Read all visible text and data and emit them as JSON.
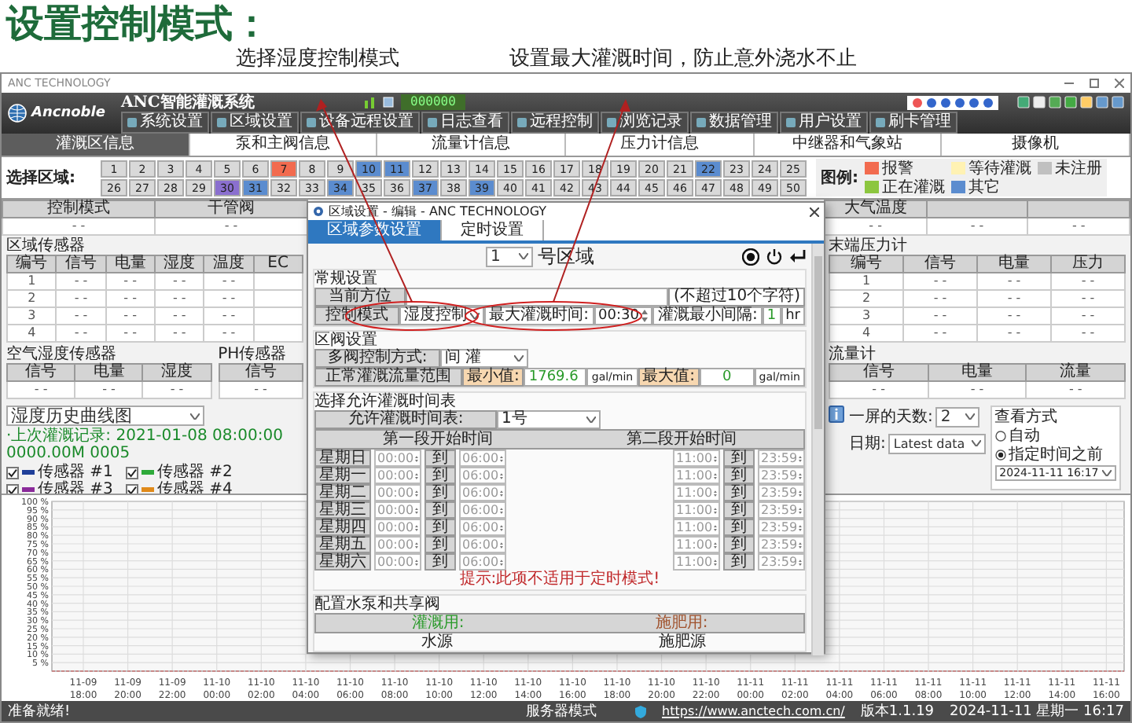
{
  "slide": {
    "title": "设置控制模式：",
    "annotations": [
      "选择湿度控制模式",
      "设置最大灌溉时间，防止意外浇水不止"
    ]
  },
  "window": {
    "title": "ANC TECHNOLOGY"
  },
  "header": {
    "brand": "Ancnoble",
    "app_title": "ANC智能灌溉系统",
    "display": "000000",
    "menu": [
      "系统设置",
      "区域设置",
      "设备远程设置",
      "日志查看",
      "远程控制",
      "浏览记录",
      "数据管理",
      "用户设置",
      "刷卡管理"
    ]
  },
  "tabs": [
    {
      "label": "灌溉区信息",
      "selected": true
    },
    {
      "label": "泵和主阀信息",
      "selected": false
    },
    {
      "label": "流量计信息",
      "selected": false
    },
    {
      "label": "压力计信息",
      "selected": false
    },
    {
      "label": "中继器和气象站",
      "selected": false
    },
    {
      "label": "摄像机",
      "selected": false
    }
  ],
  "zones": {
    "label": "选择区域:",
    "items": [
      {
        "number": "1",
        "color": "#d9d9d9"
      },
      {
        "number": "2",
        "color": "#d9d9d9"
      },
      {
        "number": "3",
        "color": "#d9d9d9"
      },
      {
        "number": "4",
        "color": "#d9d9d9"
      },
      {
        "number": "5",
        "color": "#d9d9d9"
      },
      {
        "number": "6",
        "color": "#d9d9d9"
      },
      {
        "number": "7",
        "color": "#f26b4f"
      },
      {
        "number": "8",
        "color": "#d9d9d9"
      },
      {
        "number": "9",
        "color": "#d9d9d9"
      },
      {
        "number": "10",
        "color": "#5b8ccf"
      },
      {
        "number": "11",
        "color": "#5b8ccf"
      },
      {
        "number": "12",
        "color": "#d9d9d9"
      },
      {
        "number": "13",
        "color": "#d9d9d9"
      },
      {
        "number": "14",
        "color": "#d9d9d9"
      },
      {
        "number": "15",
        "color": "#d9d9d9"
      },
      {
        "number": "16",
        "color": "#d9d9d9"
      },
      {
        "number": "17",
        "color": "#d9d9d9"
      },
      {
        "number": "18",
        "color": "#d9d9d9"
      },
      {
        "number": "19",
        "color": "#d9d9d9"
      },
      {
        "number": "20",
        "color": "#d9d9d9"
      },
      {
        "number": "21",
        "color": "#d9d9d9"
      },
      {
        "number": "22",
        "color": "#5b8ccf"
      },
      {
        "number": "23",
        "color": "#d9d9d9"
      },
      {
        "number": "24",
        "color": "#d9d9d9"
      },
      {
        "number": "25",
        "color": "#d9d9d9"
      },
      {
        "number": "26",
        "color": "#d9d9d9"
      },
      {
        "number": "27",
        "color": "#d9d9d9"
      },
      {
        "number": "28",
        "color": "#d9d9d9"
      },
      {
        "number": "29",
        "color": "#d9d9d9"
      },
      {
        "number": "30",
        "color": "#8a6fcf"
      },
      {
        "number": "31",
        "color": "#5b8ccf"
      },
      {
        "number": "32",
        "color": "#d9d9d9"
      },
      {
        "number": "33",
        "color": "#d9d9d9"
      },
      {
        "number": "34",
        "color": "#5b8ccf"
      },
      {
        "number": "35",
        "color": "#d9d9d9"
      },
      {
        "number": "36",
        "color": "#d9d9d9"
      },
      {
        "number": "37",
        "color": "#5b8ccf"
      },
      {
        "number": "38",
        "color": "#d9d9d9"
      },
      {
        "number": "39",
        "color": "#5b8ccf"
      },
      {
        "number": "40",
        "color": "#d9d9d9"
      },
      {
        "number": "41",
        "color": "#d9d9d9"
      },
      {
        "number": "42",
        "color": "#d9d9d9"
      },
      {
        "number": "43",
        "color": "#d9d9d9"
      },
      {
        "number": "44",
        "color": "#d9d9d9"
      },
      {
        "number": "45",
        "color": "#d9d9d9"
      },
      {
        "number": "46",
        "color": "#d9d9d9"
      },
      {
        "number": "47",
        "color": "#d9d9d9"
      },
      {
        "number": "48",
        "color": "#d9d9d9"
      },
      {
        "number": "49",
        "color": "#d9d9d9"
      },
      {
        "number": "50",
        "color": "#d9d9d9"
      }
    ]
  },
  "legend": {
    "title": "图例:",
    "items": [
      {
        "label": "报警",
        "color": "#f26b4f"
      },
      {
        "label": "等待灌溉",
        "color": "#fff2b3"
      },
      {
        "label": "未注册",
        "color": "#c0c0c0"
      },
      {
        "label": "正在灌溉",
        "color": "#8cc63f"
      },
      {
        "label": "其它",
        "color": "#5b8ccf"
      }
    ]
  },
  "summary": {
    "left": [
      {
        "header": "控制模式",
        "value": "- -"
      },
      {
        "header": "干管阀",
        "value": "- -"
      }
    ],
    "right": [
      {
        "header": "大气温度",
        "value": "- -"
      },
      {
        "value": "- -"
      },
      {
        "value": "- -"
      }
    ]
  },
  "zone_sensors": {
    "title": "区域传感器",
    "columns": [
      "编号",
      "信号",
      "电量",
      "湿度",
      "温度",
      "EC"
    ],
    "rows": [
      [
        "1",
        "- -",
        "- -",
        "- -",
        "- -"
      ],
      [
        "2",
        "- -",
        "- -",
        "- -",
        "- -"
      ],
      [
        "3",
        "- -",
        "- -",
        "- -",
        "- -"
      ],
      [
        "4",
        "- -",
        "- -",
        "- -",
        "- -"
      ]
    ]
  },
  "air_sensor": {
    "title": "空气湿度传感器",
    "columns": [
      "信号",
      "电量",
      "湿度"
    ],
    "row": [
      "- -",
      "- -",
      "- -"
    ]
  },
  "ph_sensor": {
    "title": "PH传感器",
    "columns": [
      "信号"
    ],
    "row": [
      "- -"
    ]
  },
  "pressure": {
    "title": "末端压力计",
    "columns": [
      "编号",
      "信号",
      "电量",
      "压力"
    ],
    "rows": [
      [
        "1",
        "- -",
        "- -",
        "- -"
      ],
      [
        "2",
        "- -",
        "- -",
        "- -"
      ],
      [
        "3",
        "- -",
        "- -",
        "- -"
      ],
      [
        "4",
        "- -",
        "- -",
        "- -"
      ]
    ]
  },
  "flow": {
    "title": "流量计",
    "columns": [
      "信号",
      "电量",
      "流量"
    ],
    "row": [
      "- -",
      "- -",
      "- -"
    ]
  },
  "chart_panel": {
    "selector": "湿度历史曲线图",
    "last_record": "·上次灌溉记录: 2021-01-08 08:00:00 0000.00M 0005",
    "legend": [
      {
        "checked": true
      },
      {
        "checked": true
      },
      {
        "checked": true
      },
      {
        "checked": true
      }
    ],
    "days_label": "一屏的天数:",
    "days": "2",
    "date_label": "日期:",
    "date": "Latest data",
    "view_mode": {
      "title": "查看方式",
      "options": [
        {
          "label": "自动",
          "selected": false
        },
        {
          "label": "指定时间之前",
          "selected": true
        }
      ],
      "datetime": "2024-11-11 16:17"
    },
    "chart_data": {
      "type": "line",
      "grid": true,
      "categories": [
        "11-09 18:00",
        "11-09 20:00",
        "11-09 22:00",
        "11-10 00:00",
        "11-10 02:00",
        "11-10 04:00",
        "11-10 06:00",
        "11-10 08:00",
        "11-10 10:00",
        "11-10 12:00",
        "11-10 14:00",
        "11-10 16:00",
        "11-10 18:00",
        "11-10 20:00",
        "11-10 22:00",
        "11-11 00:00",
        "11-11 02:00",
        "11-11 04:00",
        "11-11 06:00",
        "11-11 08:00",
        "11-11 10:00",
        "11-11 12:00",
        "11-11 14:00",
        "11-11 16:00"
      ],
      "ylim": [
        0,
        100
      ],
      "yticks": [
        {
          "value": 5,
          "label": "5 %"
        },
        {
          "value": 10,
          "label": "10 %"
        },
        {
          "value": 15,
          "label": "15 %"
        },
        {
          "value": 20,
          "label": "20 %"
        },
        {
          "value": 25,
          "label": "25 %"
        },
        {
          "value": 30,
          "label": "30 %"
        },
        {
          "value": 35,
          "label": "35 %"
        },
        {
          "value": 40,
          "label": "40 %"
        },
        {
          "value": 45,
          "label": "45 %"
        },
        {
          "value": 50,
          "label": "50 %"
        },
        {
          "value": 55,
          "label": "55 %"
        },
        {
          "value": 60,
          "label": "60 %"
        },
        {
          "value": 65,
          "label": "65 %"
        },
        {
          "value": 70,
          "label": "70 %"
        },
        {
          "value": 75,
          "label": "75 %"
        },
        {
          "value": 80,
          "label": "80 %"
        },
        {
          "value": 85,
          "label": "85 %"
        },
        {
          "value": 90,
          "label": "90 %"
        },
        {
          "value": 95,
          "label": "95 %"
        },
        {
          "value": 100,
          "label": "100 %"
        }
      ],
      "series": [
        {
          "name": "传感器 #1",
          "color": "#1f3f99",
          "values": [
            null,
            null,
            null,
            null,
            null,
            null,
            null,
            null,
            null,
            null,
            null,
            null,
            null,
            null,
            null,
            null,
            null,
            null,
            null,
            null,
            null,
            null,
            null,
            null
          ]
        },
        {
          "name": "传感器 #2",
          "color": "#2eaa3a",
          "values": [
            null,
            null,
            null,
            null,
            null,
            null,
            null,
            null,
            null,
            null,
            null,
            null,
            null,
            null,
            null,
            null,
            null,
            null,
            null,
            null,
            null,
            null,
            null,
            null
          ]
        },
        {
          "name": "传感器 #3",
          "color": "#8a2a9a",
          "values": [
            null,
            null,
            null,
            null,
            null,
            null,
            null,
            null,
            null,
            null,
            null,
            null,
            null,
            null,
            null,
            null,
            null,
            null,
            null,
            null,
            null,
            null,
            null,
            null
          ]
        },
        {
          "name": "传感器 #4",
          "color": "#e08a1a",
          "values": [
            null,
            null,
            null,
            null,
            null,
            null,
            null,
            null,
            null,
            null,
            null,
            null,
            null,
            null,
            null,
            null,
            null,
            null,
            null,
            null,
            null,
            null,
            null,
            null
          ]
        }
      ]
    }
  },
  "status_bar": {
    "status": "准备就绪!",
    "mode": "服务器模式",
    "url": "https://www.anctech.com.cn/",
    "version": "版本1.1.19",
    "datetime": "2024-11-11 星期一 16:17"
  },
  "dialog": {
    "title": "区域设置 - 编辑 - ANC TECHNOLOGY",
    "tabs": [
      {
        "label": "区域参数设置",
        "selected": true
      },
      {
        "label": "定时设置",
        "selected": false
      }
    ],
    "zone": "1",
    "zone_suffix": "号区域",
    "general": {
      "title": "常规设置",
      "location_label": "当前方位",
      "location_hint": "(不超过10个字符)",
      "mode_label": "控制模式",
      "mode": "湿度控制",
      "max_time_label": "最大灌溉时间:",
      "max_time": "00:30",
      "min_interval_label": "灌溉最小间隔:",
      "min_interval": "1",
      "unit": "hr"
    },
    "valve": {
      "title": "区阀设置",
      "method_label": "多阀控制方式:",
      "method": "间 灌",
      "flow_label": "正常灌溉流量范围",
      "min_label": "最小值:",
      "min": "1769.6",
      "min_unit": "gal/min",
      "max_label": "最大值:",
      "max": "0",
      "max_unit": "gal/min"
    },
    "schedule": {
      "title": "选择允许灌溉时间表",
      "table_label": "允许灌溉时间表:",
      "table": "1号",
      "first_header": "第一段开始时间",
      "second_header": "第二段开始时间",
      "rows": [
        {
          "day": "星期日",
          "first": [
            "00:00",
            "到",
            "06:00"
          ],
          "second": [
            "11:00",
            "到",
            "23:59"
          ]
        },
        {
          "day": "星期一",
          "first": [
            "00:00",
            "到",
            "06:00"
          ],
          "second": [
            "11:00",
            "到",
            "23:59"
          ]
        },
        {
          "day": "星期二",
          "first": [
            "00:00",
            "到",
            "06:00"
          ],
          "second": [
            "11:00",
            "到",
            "23:59"
          ]
        },
        {
          "day": "星期三",
          "first": [
            "00:00",
            "到",
            "06:00"
          ],
          "second": [
            "11:00",
            "到",
            "23:59"
          ]
        },
        {
          "day": "星期四",
          "first": [
            "00:00",
            "到",
            "06:00"
          ],
          "second": [
            "11:00",
            "到",
            "23:59"
          ]
        },
        {
          "day": "星期五",
          "first": [
            "00:00",
            "到",
            "06:00"
          ],
          "second": [
            "11:00",
            "到",
            "23:59"
          ]
        },
        {
          "day": "星期六",
          "first": [
            "00:00",
            "到",
            "06:00"
          ],
          "second": [
            "11:00",
            "到",
            "23:59"
          ]
        }
      ],
      "hint": "提示:此项不适用于定时模式!"
    },
    "pumps": {
      "title": "配置水泵和共享阀",
      "irrigation_label": "灌溉用:",
      "fertilizer_label": "施肥用:",
      "water_source": "水源",
      "fertilizer_source": "施肥源"
    }
  }
}
